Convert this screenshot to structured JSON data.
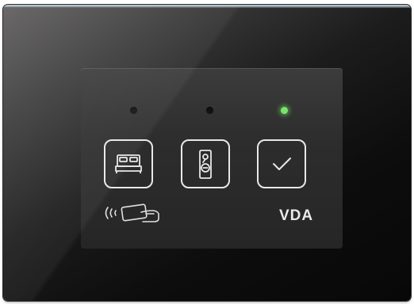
{
  "device": {
    "brand_logo": "VDA",
    "indicators": [
      {
        "name": "do-not-disturb",
        "state": "off"
      },
      {
        "name": "make-up-room",
        "state": "off"
      },
      {
        "name": "ready",
        "state": "on",
        "color": "#7be36c"
      }
    ],
    "keys": [
      {
        "icon": "bed-icon"
      },
      {
        "icon": "door-hanger-icon"
      },
      {
        "icon": "checkmark-icon"
      }
    ],
    "card_reader_icon": "contactless-card-icon"
  }
}
